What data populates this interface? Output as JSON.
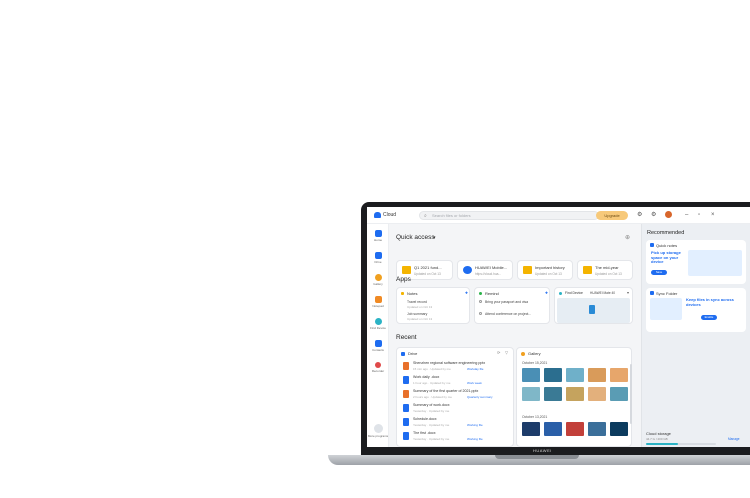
{
  "device": {
    "brand": "HUAWEI"
  },
  "titlebar": {
    "app_name": "Cloud",
    "search_placeholder": "Search files or folders",
    "upgrade_label": "Upgrade"
  },
  "sidebar": {
    "items": [
      {
        "label": "Home",
        "color": "#1e6cf0"
      },
      {
        "label": "Drive",
        "color": "#1e6cf0"
      },
      {
        "label": "Gallery",
        "color": "#f0a020"
      },
      {
        "label": "Notepad",
        "color": "#f08a24"
      },
      {
        "label": "Find Device",
        "color": "#2bb3c5"
      },
      {
        "label": "Contacts",
        "color": "#1e6cf0"
      },
      {
        "label": "Recorder",
        "color": "#e04a4a"
      }
    ],
    "account_label": "More programs"
  },
  "quick_access": {
    "title": "Quick access",
    "items": [
      {
        "title": "Q1 2021 fund...",
        "meta": "Updated on Oct 13",
        "color": "#f4b400"
      },
      {
        "title": "HUAWEI Mobile...",
        "meta": "https://cloud.hua...",
        "color": "#1e6cf0"
      },
      {
        "title": "Important history",
        "meta": "Updated on Oct 13",
        "color": "#f4b400"
      },
      {
        "title": "The mid-year",
        "meta": "Updated on Oct 13",
        "color": "#f4b400"
      }
    ]
  },
  "apps": {
    "title": "Apps",
    "notes": {
      "title": "Notes",
      "lines": [
        {
          "text": "Travel record",
          "meta": "Updated on Oct 13"
        },
        {
          "text": "Job summary",
          "meta": "Updated on Oct 13"
        }
      ]
    },
    "reminder": {
      "title": "Remind",
      "lines": [
        {
          "text": "Bring your passport and visa",
          "meta": ""
        },
        {
          "text": "Attend conference on project...",
          "meta": ""
        }
      ]
    },
    "find_device": {
      "title": "Find Device",
      "device": "HUAWEI Mate 40"
    }
  },
  "recent": {
    "title": "Recent",
    "drive_title": "Drive",
    "files": [
      {
        "title": "Shenzhen regional software engineering pptx",
        "meta": "15 min ago · Updated by me",
        "link": "Workday file",
        "color": "#e8702a"
      },
      {
        "title": "Work daily .docx",
        "meta": "1 hour ago · Updated by me",
        "link": "Work week",
        "color": "#1e6cf0"
      },
      {
        "title": "Summary of the first quarter of 2021.pptx",
        "meta": "2 hours ago · Updated by me",
        "link": "Quarterly summary",
        "color": "#e8702a"
      },
      {
        "title": "Summary of work.docx",
        "meta": "Yesterday · Updated by me",
        "link": "",
        "color": "#1e6cf0"
      },
      {
        "title": "Schedule.docx",
        "meta": "Yesterday · Updated by me",
        "link": "Working file",
        "color": "#1e6cf0"
      },
      {
        "title": "The first .docx",
        "meta": "Yesterday · Updated by me",
        "link": "Working file",
        "color": "#1e6cf0"
      }
    ],
    "gallery_title": "Gallery",
    "gallery_dates": [
      "October 15,2021",
      "October 13,2021"
    ],
    "photo_colors": [
      "#4a8fb5",
      "#2b6e8f",
      "#6fb0c9",
      "#d99b5a",
      "#e7a66b",
      "#7fb7c8",
      "#3a7a95",
      "#c5a35e",
      "#e3b07c",
      "#5a9cb4",
      "#1d3c6a",
      "#2a5fa8",
      "#c2403a",
      "#3b6f9a",
      "#0c3b5e"
    ]
  },
  "right_panel": {
    "title": "Recommended",
    "quick_notes": {
      "title": "Quick notes",
      "body": "Pick up storage space on your device",
      "button": "Save"
    },
    "sync_folder": {
      "title": "Sync Folder",
      "body": "Keep files in sync across devices",
      "button": "Enable"
    },
    "cloud_storage": {
      "title": "Cloud storage",
      "used": "44.7 G / 200 GB",
      "manage": "Manage",
      "used_fraction": 0.45
    }
  }
}
